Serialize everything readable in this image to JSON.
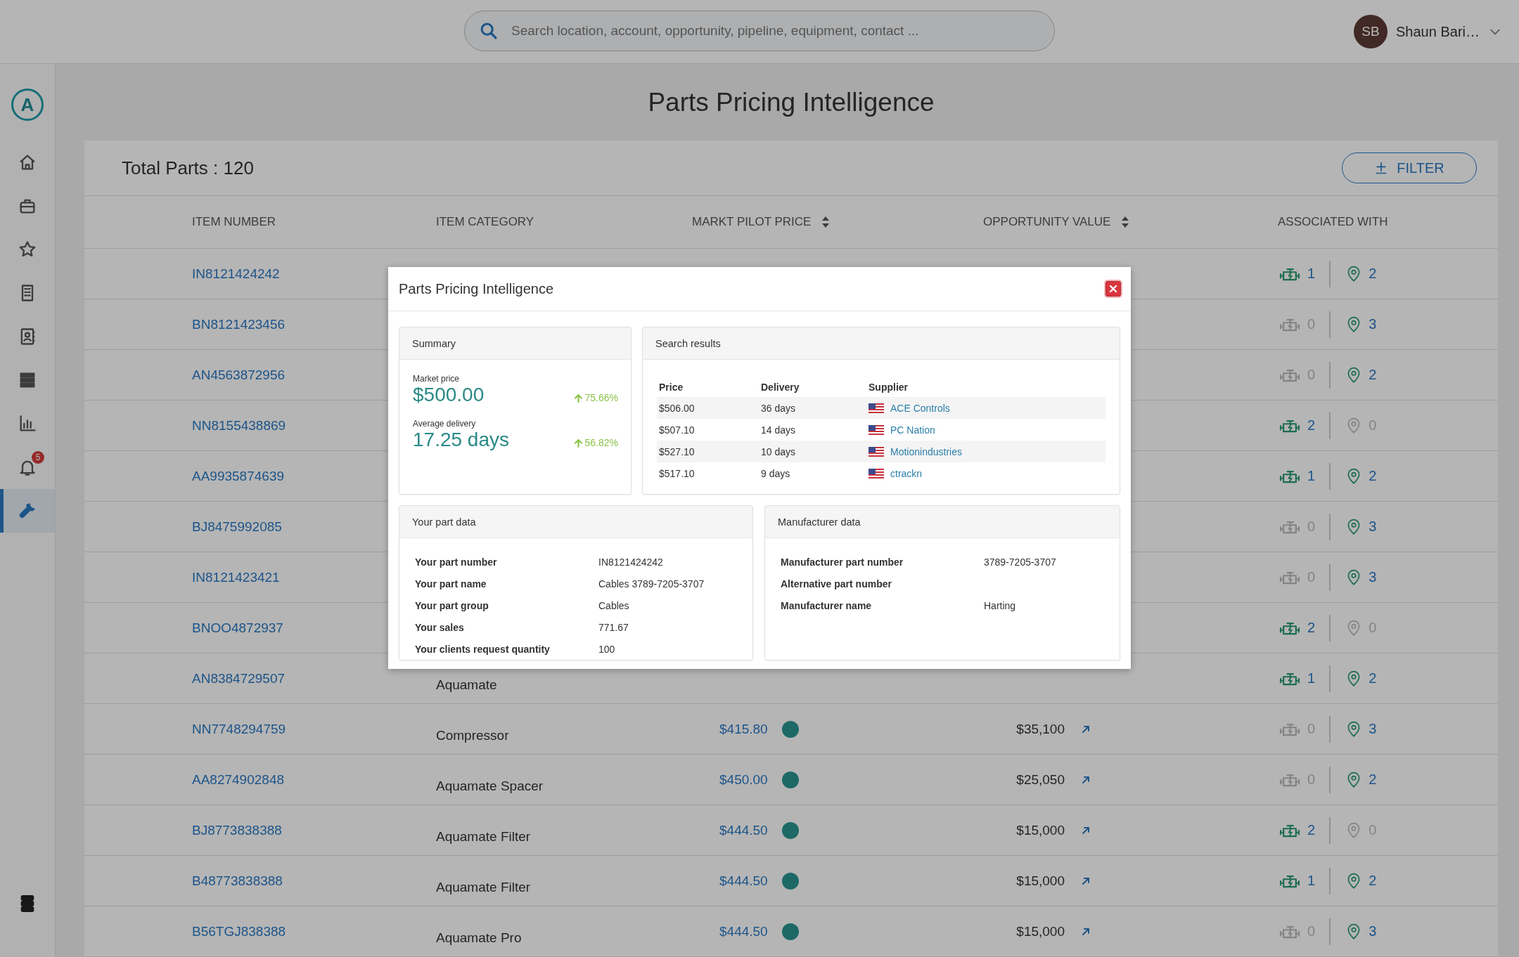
{
  "topbar": {
    "search": {
      "placeholder": "Search location, account, opportunity, pipeline, equipment, contact ..."
    },
    "user": {
      "initials": "SB",
      "name": "Shaun Bari…"
    }
  },
  "sidebar": {
    "logo": "A",
    "items": [
      {
        "kind": "home",
        "selected": false
      },
      {
        "kind": "briefcase",
        "selected": false
      },
      {
        "kind": "star",
        "selected": false
      },
      {
        "kind": "building",
        "selected": false
      },
      {
        "kind": "contacts",
        "selected": false
      },
      {
        "kind": "list",
        "selected": false
      },
      {
        "kind": "chart",
        "selected": false
      },
      {
        "kind": "bell",
        "badge": "5",
        "selected": false
      },
      {
        "kind": "wrench",
        "selected": true
      }
    ],
    "bottom": {
      "kind": "menu"
    }
  },
  "page_title": "Parts Pricing Intelligence",
  "parts": {
    "total": "Total Parts : 120",
    "filter_button": "FILTER",
    "columns": [
      {
        "label": "ITEM NUMBER",
        "sortable": false
      },
      {
        "label": "ITEM CATEGORY",
        "sortable": false
      },
      {
        "label": "MARKT PILOT PRICE",
        "sortable": true
      },
      {
        "label": "OPPORTUNITY VALUE",
        "sortable": true
      },
      {
        "label": "ASSOCIATED WITH",
        "sortable": false
      }
    ],
    "rows": [
      {
        "item_number": "IN8121424242",
        "equipment": {
          "count": "1",
          "active": true
        },
        "locations": {
          "count": "2",
          "active": true
        }
      },
      {
        "item_number": "BN8121423456",
        "equipment": {
          "count": "0",
          "active": false
        },
        "locations": {
          "count": "3",
          "active": true
        }
      },
      {
        "item_number": "AN4563872956",
        "equipment": {
          "count": "0",
          "active": false
        },
        "locations": {
          "count": "2",
          "active": true
        }
      },
      {
        "item_number": "NN8155438869",
        "equipment": {
          "count": "2",
          "active": true
        },
        "locations": {
          "count": "0",
          "active": false
        }
      },
      {
        "item_number": "AA9935874639",
        "equipment": {
          "count": "1",
          "active": true
        },
        "locations": {
          "count": "2",
          "active": true
        }
      },
      {
        "item_number": "BJ8475992085",
        "equipment": {
          "count": "0",
          "active": false
        },
        "locations": {
          "count": "3",
          "active": true
        }
      },
      {
        "item_number": "IN8121423421",
        "equipment": {
          "count": "0",
          "active": false
        },
        "locations": {
          "count": "3",
          "active": true
        }
      },
      {
        "item_number": "BNOO4872937",
        "equipment": {
          "count": "2",
          "active": true
        },
        "locations": {
          "count": "0",
          "active": false
        }
      },
      {
        "item_number": "AN8384729507",
        "category": "Aquamate",
        "equipment": {
          "count": "1",
          "active": true
        },
        "locations": {
          "count": "2",
          "active": true
        }
      },
      {
        "item_number": "NN7748294759",
        "category": "Compressor",
        "price": "$415.80",
        "opportunity_value": "$35,100",
        "equipment": {
          "count": "0",
          "active": false
        },
        "locations": {
          "count": "3",
          "active": true
        }
      },
      {
        "item_number": "AA8274902848",
        "category": "Aquamate Spacer",
        "price": "$450.00",
        "opportunity_value": "$25,050",
        "equipment": {
          "count": "0",
          "active": false
        },
        "locations": {
          "count": "2",
          "active": true
        }
      },
      {
        "item_number": "BJ8773838388",
        "category": "Aquamate Filter",
        "price": "$444.50",
        "opportunity_value": "$15,000",
        "equipment": {
          "count": "2",
          "active": true
        },
        "locations": {
          "count": "0",
          "active": false
        }
      },
      {
        "item_number": "B48773838388",
        "category": "Aquamate Filter",
        "price": "$444.50",
        "opportunity_value": "$15,000",
        "equipment": {
          "count": "1",
          "active": true
        },
        "locations": {
          "count": "2",
          "active": true
        }
      },
      {
        "item_number": "B56TGJ838388",
        "category": "Aquamate Pro",
        "price": "$444.50",
        "opportunity_value": "$15,000",
        "equipment": {
          "count": "0",
          "active": false
        },
        "locations": {
          "count": "3",
          "active": true
        }
      }
    ]
  },
  "modal": {
    "title": "Parts Pricing Intelligence",
    "summary": {
      "title": "Summary",
      "metrics": [
        {
          "label": "Market price",
          "value": "$500.00",
          "change": "75.66%"
        },
        {
          "label": "Average delivery",
          "value": "17.25 days",
          "change": "56.82%"
        }
      ]
    },
    "search_results": {
      "title": "Search results",
      "columns": [
        "Price",
        "Delivery",
        "Supplier"
      ],
      "rows": [
        {
          "price": "$506.00",
          "delivery": "36 days",
          "supplier": "ACE Controls"
        },
        {
          "price": "$507.10",
          "delivery": "14 days",
          "supplier": "PC Nation"
        },
        {
          "price": "$527.10",
          "delivery": "10 days",
          "supplier": "Motionindustries"
        },
        {
          "price": "$517.10",
          "delivery": "9 days",
          "supplier": "ctrackn"
        }
      ]
    },
    "part_data": {
      "title": "Your part data",
      "fields": [
        {
          "label": "Your part number",
          "value": "IN8121424242"
        },
        {
          "label": "Your part name",
          "value": "Cables 3789-7205-3707"
        },
        {
          "label": "Your part group",
          "value": "Cables"
        },
        {
          "label": "Your sales",
          "value": "771.67"
        },
        {
          "label": "Your clients request quantity",
          "value": "100"
        }
      ]
    },
    "manufacturer_data": {
      "title": "Manufacturer data",
      "fields": [
        {
          "label": "Manufacturer part number",
          "value": "3789-7205-3707"
        },
        {
          "label": "Alternative part number"
        },
        {
          "label": "Manufacturer name",
          "value": "Harting"
        }
      ]
    }
  }
}
